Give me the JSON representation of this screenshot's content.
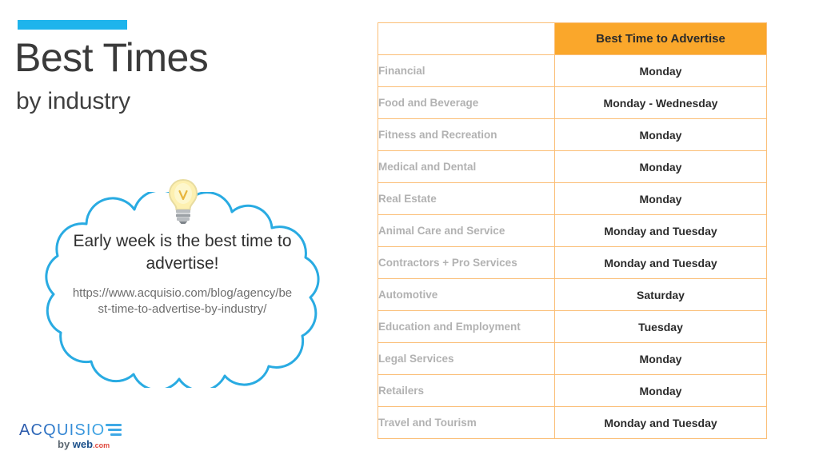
{
  "slide": {
    "title": "Best Times",
    "subtitle": "by industry",
    "accent_color": "#1EB4EC"
  },
  "callout": {
    "headline": "Early week is the best time to advertise!",
    "url": "https://www.acquisio.com/blog/agency/best-time-to-advertise-by-industry/",
    "outline_color": "#29ABE2",
    "icon": "lightbulb-icon"
  },
  "logo": {
    "wordmark": "ACQUISIO",
    "byline_prefix": "by ",
    "byline_brand": "web",
    "byline_suffix": ".com"
  },
  "table": {
    "header_color": "#FAA72B",
    "border_color": "#FBBE76",
    "columns": [
      "",
      "Best Time to Advertise"
    ],
    "rows": [
      {
        "industry": "Financial",
        "best_time": "Monday"
      },
      {
        "industry": "Food and Beverage",
        "best_time": "Monday - Wednesday"
      },
      {
        "industry": "Fitness and Recreation",
        "best_time": "Monday"
      },
      {
        "industry": "Medical and Dental",
        "best_time": "Monday"
      },
      {
        "industry": "Real Estate",
        "best_time": "Monday"
      },
      {
        "industry": "Animal Care and Service",
        "best_time": "Monday and Tuesday"
      },
      {
        "industry": "Contractors + Pro Services",
        "best_time": "Monday and Tuesday"
      },
      {
        "industry": "Automotive",
        "best_time": "Saturday"
      },
      {
        "industry": "Education and Employment",
        "best_time": "Tuesday"
      },
      {
        "industry": "Legal Services",
        "best_time": "Monday"
      },
      {
        "industry": "Retailers",
        "best_time": "Monday"
      },
      {
        "industry": "Travel and Tourism",
        "best_time": "Monday and Tuesday"
      }
    ]
  }
}
